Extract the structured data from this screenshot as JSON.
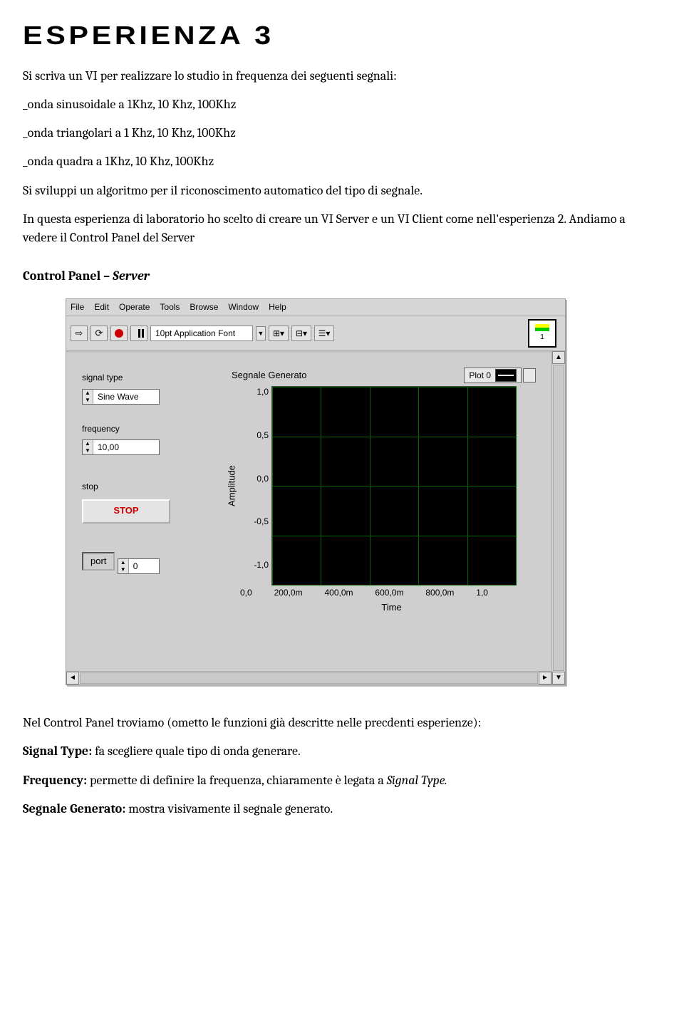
{
  "title_banner": "Esperienza 3",
  "intro_line": "Si scriva un VI per realizzare lo studio in frequenza dei seguenti segnali:",
  "list_a": "_onda sinusoidale a 1Khz, 10 Khz, 100Khz",
  "list_b": "_onda triangolari a 1 Khz, 10 Khz, 100Khz",
  "list_c": "_onda quadra a 1Khz, 10 Khz, 100Khz",
  "para_algo": "Si sviluppi un algoritmo per il riconoscimento automatico del tipo di segnale.",
  "para_lab": "In questa esperienza di laboratorio ho scelto di creare un VI Server e un VI Client come nell'esperienza 2. Andiamo a vedere il Control Panel del Server",
  "section_cp_label": "Control Panel –",
  "section_cp_target": "Server",
  "cp_desc": "Nel Control Panel troviamo (ometto le funzioni già descritte nelle precdenti esperienze):",
  "signal_type_k": "Signal Type:",
  "signal_type_v": " fa scegliere quale tipo di onda generare.",
  "frequency_k": "Frequency:",
  "frequency_v_pre": " permette di definire la frequenza, chiaramente è legata a ",
  "frequency_v_i": "Signal Type.",
  "seg_gen_k": "Segnale Generato:",
  "seg_gen_v": " mostra visivamente il segnale generato.",
  "menu": {
    "file": "File",
    "edit": "Edit",
    "operate": "Operate",
    "tools": "Tools",
    "browse": "Browse",
    "window": "Window",
    "help": "Help"
  },
  "fontbox": "10pt Application Font",
  "controls": {
    "signal_type_label": "signal type",
    "signal_type_value": "Sine Wave",
    "frequency_label": "frequency",
    "frequency_value": "10,00",
    "stop_label": "stop",
    "stop_button": "STOP",
    "port_label": "port",
    "port_value": "0"
  },
  "plot": {
    "title": "Segnale Generato",
    "legend": "Plot 0",
    "ylabel": "Amplitude",
    "xlabel": "Time",
    "yticks": [
      "1,0",
      "0,5",
      "0,0",
      "-0,5",
      "-1,0"
    ],
    "xticks": [
      "0,0",
      "200,0m",
      "400,0m",
      "600,0m",
      "800,0m",
      "1,0"
    ]
  },
  "panel_icon_num": "1"
}
